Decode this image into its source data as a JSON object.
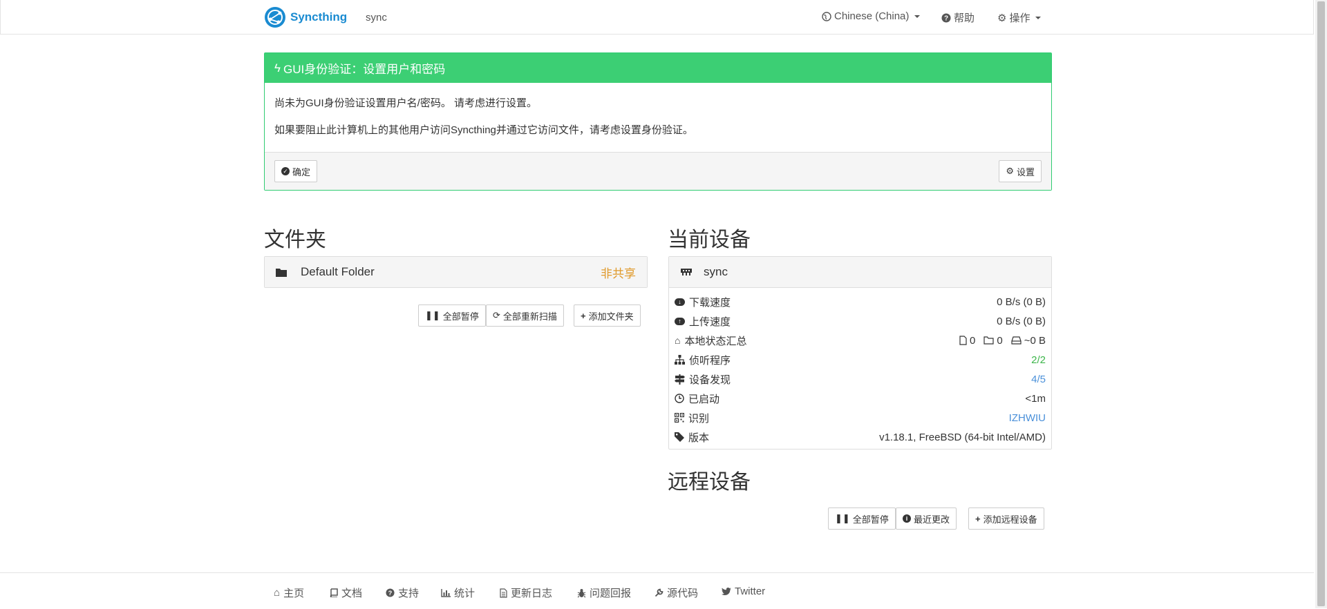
{
  "navbar": {
    "brand": "Syncthing",
    "device": "sync",
    "language": "Chinese (China)",
    "help": "帮助",
    "actions": "操作"
  },
  "alert": {
    "title": "GUI身份验证：设置用户和密码",
    "line1": "尚未为GUI身份验证设置用户名/密码。 请考虑进行设置。",
    "line2": "如果要阻止此计算机上的其他用户访问Syncthing并通过它访问文件，请考虑设置身份验证。",
    "ok_label": "确定",
    "settings_label": "设置"
  },
  "folders": {
    "heading": "文件夹",
    "items": [
      {
        "name": "Default Folder",
        "status": "非共享"
      }
    ],
    "pause_all": "全部暂停",
    "rescan_all": "全部重新扫描",
    "add_folder": "添加文件夹"
  },
  "this_device": {
    "heading": "当前设备",
    "name": "sync",
    "rows": {
      "download": {
        "label": "下载速度",
        "value": "0 B/s (0 B)"
      },
      "upload": {
        "label": "上传速度",
        "value": "0 B/s (0 B)"
      },
      "local_state": {
        "label": "本地状态汇总",
        "files": "0",
        "dirs": "0",
        "size": "~0 B"
      },
      "listeners": {
        "label": "侦听程序",
        "value": "2/2"
      },
      "discovery": {
        "label": "设备发现",
        "value": "4/5"
      },
      "uptime": {
        "label": "已启动",
        "value": "<1m"
      },
      "identity": {
        "label": "识别",
        "value": "IZHWIU"
      },
      "version": {
        "label": "版本",
        "value": "v1.18.1, FreeBSD (64-bit Intel/AMD)"
      }
    }
  },
  "remote_devices": {
    "heading": "远程设备",
    "pause_all": "全部暂停",
    "recent_changes": "最近更改",
    "add_device": "添加远程设备"
  },
  "footer": {
    "home": "主页",
    "docs": "文档",
    "support": "支持",
    "stats": "统计",
    "changelog": "更新日志",
    "bugs": "问题回报",
    "source": "源代码",
    "twitter": "Twitter"
  },
  "colors": {
    "brand": "#1a8bd1",
    "success": "#3ccf74",
    "unshared": "#e09a2b",
    "link": "#4a90d9",
    "green_value": "#3cb54a"
  }
}
